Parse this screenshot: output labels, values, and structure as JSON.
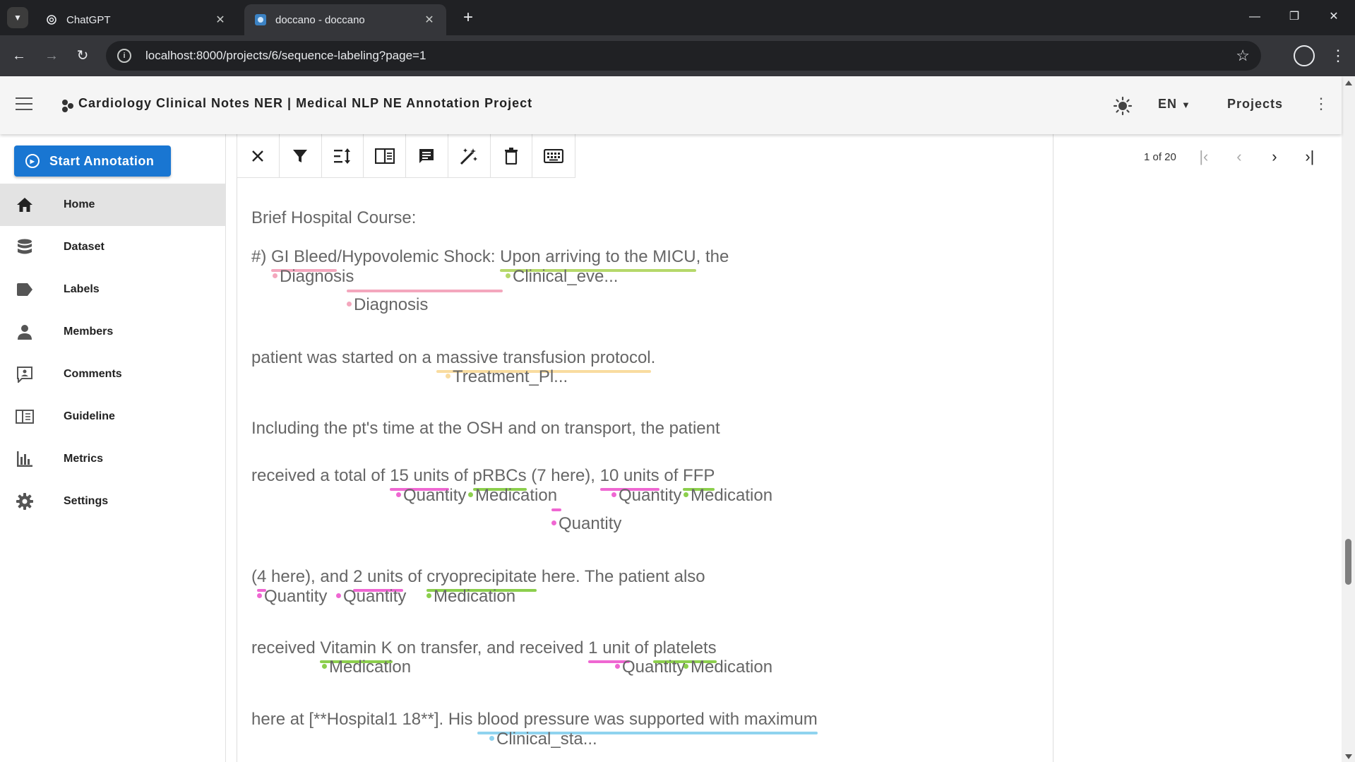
{
  "browser": {
    "tabs": [
      {
        "title": "ChatGPT",
        "active": false
      },
      {
        "title": "doccano - doccano",
        "active": true
      }
    ],
    "url": "localhost:8000/projects/6/sequence-labeling?page=1"
  },
  "app": {
    "title": "Cardiology Clinical Notes NER | Medical NLP NE Annotation Project",
    "lang": "EN",
    "projects_label": "Projects"
  },
  "sidebar": {
    "start_label": "Start Annotation",
    "items": [
      {
        "label": "Home",
        "icon": "home-icon",
        "active": true
      },
      {
        "label": "Dataset",
        "icon": "database-icon"
      },
      {
        "label": "Labels",
        "icon": "label-icon"
      },
      {
        "label": "Members",
        "icon": "person-icon"
      },
      {
        "label": "Comments",
        "icon": "comment-icon"
      },
      {
        "label": "Guideline",
        "icon": "book-icon"
      },
      {
        "label": "Metrics",
        "icon": "chart-icon"
      },
      {
        "label": "Settings",
        "icon": "gear-icon"
      }
    ]
  },
  "pager": {
    "count": "1 of 20"
  },
  "colors": {
    "diagnosis": "#f4a7bd",
    "clinical": "#b5d86a",
    "treatment": "#f9dca0",
    "quantity": "#ef67d2",
    "medication": "#8ccf4d",
    "clinical_status": "#8fd3ef",
    "primary": "#1976d2"
  },
  "doc": {
    "l1": "Brief Hospital Course:",
    "l2_pre": "#) ",
    "l2_gi": "GI Bleed",
    "l2_mid": "/Hypovolemic Shock: ",
    "l2_upon": "Upon arriving to the MICU",
    "l2_post": ", the",
    "lab_diagnosis": "Diagnosis",
    "lab_clinical_eve": "Clinical_eve...",
    "l3_pre": "patient was started on a ",
    "l3_mtp": "massive transfusion protocol",
    "l3_post": ".",
    "lab_treatment": "Treatment_Pl...",
    "l4": "Including the pt's time at the OSH and on transport, the patient",
    "l5_a": "received a total of ",
    "l5_q1": "15 units",
    "l5_b": " of ",
    "l5_m1": "pRBCs",
    "l5_c": " (7 here), ",
    "l5_q2": "10 units",
    "l5_d": " of ",
    "l5_m2": "FFP",
    "lab_quantity": "Quantity",
    "lab_medication": "Medication",
    "l6_a": "(",
    "l6_q1": "4",
    "l6_b": " here), and ",
    "l6_q2": "2 units",
    "l6_c": " of ",
    "l6_m": "cryoprecipitate",
    "l6_d": " here.  The patient also",
    "l7_a": "received ",
    "l7_m1": "Vitamin K",
    "l7_b": " on transfer, and received ",
    "l7_q": "1 unit",
    "l7_c": " of ",
    "l7_m2": "platelets",
    "l8_a": "here at [**Hospital1 18**].  His ",
    "l8_bp": "blood pressure was supported with maximum",
    "lab_clinical_sta": "Clinical_sta..."
  }
}
